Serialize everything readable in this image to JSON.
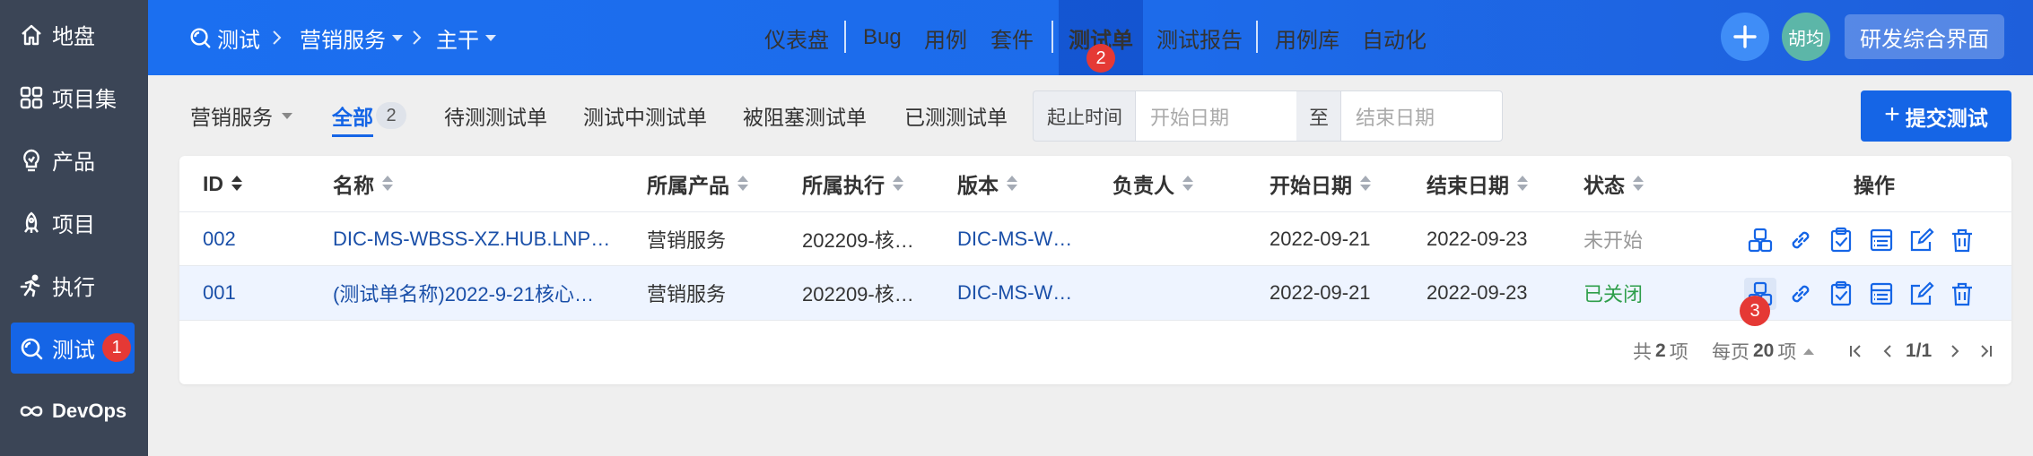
{
  "sidebar": {
    "items": [
      {
        "label": "地盘",
        "icon": "home-icon"
      },
      {
        "label": "项目集",
        "icon": "grid-icon"
      },
      {
        "label": "产品",
        "icon": "bulb-icon"
      },
      {
        "label": "项目",
        "icon": "rocket-icon"
      },
      {
        "label": "执行",
        "icon": "run-icon"
      },
      {
        "label": "测试",
        "icon": "search-icon",
        "badge": "1"
      },
      {
        "label": "DevOps",
        "icon": "infinity-icon"
      }
    ]
  },
  "header": {
    "breadcrumb": [
      "测试",
      "营销服务",
      "主干"
    ],
    "nav": [
      "仪表盘",
      "Bug",
      "用例",
      "套件",
      "测试单",
      "测试报告",
      "用例库",
      "自动化"
    ],
    "active_nav_badge": "2",
    "avatar_text": "胡均",
    "workspace_button": "研发综合界面",
    "accent": "#1b6ff0"
  },
  "filter": {
    "product_select": "营销服务",
    "tabs": [
      "全部",
      "待测测试单",
      "测试中测试单",
      "被阻塞测试单",
      "已测测试单"
    ],
    "all_count": "2",
    "date_label": "起止时间",
    "start_placeholder": "开始日期",
    "to_label": "至",
    "end_placeholder": "结束日期",
    "submit_label": "提交测试"
  },
  "table": {
    "columns": [
      "ID",
      "名称",
      "所属产品",
      "所属执行",
      "版本",
      "负责人",
      "开始日期",
      "结束日期",
      "状态",
      "操作"
    ],
    "rows": [
      {
        "id": "002",
        "name": "DIC-MS-WBSS-XZ.HUB.LNP…",
        "product": "营销服务",
        "execution": "202209-核…",
        "version": "DIC-MS-W…",
        "owner": "",
        "start": "2022-09-21",
        "end": "2022-09-23",
        "status": "未开始"
      },
      {
        "id": "001",
        "name": "(测试单名称)2022-9-21核心…",
        "product": "营销服务",
        "execution": "202209-核…",
        "version": "DIC-MS-W…",
        "owner": "",
        "start": "2022-09-21",
        "end": "2022-09-23",
        "status": "已关闭"
      }
    ],
    "action_badge": "3",
    "status_colors": {
      "未开始": "#999999",
      "已关闭": "#2e9e4a"
    }
  },
  "pager": {
    "total_prefix": "共",
    "total": "2",
    "total_suffix": "项",
    "per_page_prefix": "每页",
    "per_page": "20",
    "per_page_suffix": "项",
    "page": "1/1"
  }
}
